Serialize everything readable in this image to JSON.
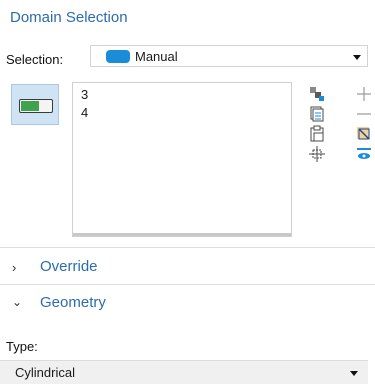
{
  "section": {
    "title": "Domain Selection"
  },
  "selection": {
    "label": "Selection:",
    "value": "Manual",
    "swatch_color": "#1a8cd8"
  },
  "active_toggle": {
    "icon": "active-toggle-icon"
  },
  "list": {
    "items": [
      "3",
      "4"
    ]
  },
  "toolbar_left": [
    "copy-icon",
    "paste-list-icon",
    "clipboard-icon",
    "zoom-selection-icon"
  ],
  "toolbar_right": [
    "add-icon",
    "remove-icon",
    "clear-selection-icon",
    "create-selection-icon"
  ],
  "override": {
    "title": "Override",
    "state": "collapsed"
  },
  "geometry": {
    "title": "Geometry",
    "state": "expanded"
  },
  "type": {
    "label": "Type:",
    "value": "Cylindrical"
  }
}
